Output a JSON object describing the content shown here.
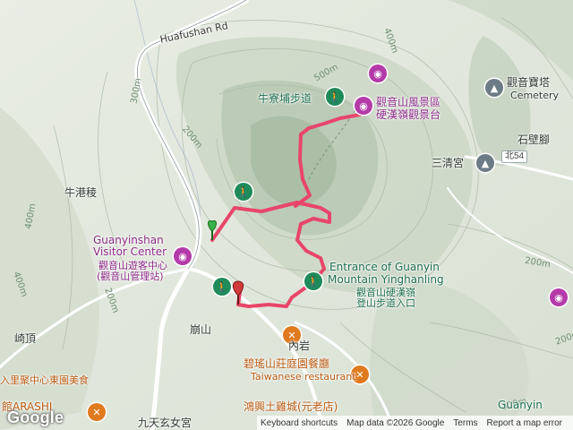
{
  "map": {
    "roads": {
      "main_road": "Huafushan Rd",
      "route_badge": "北54"
    },
    "contours": [
      "400m",
      "500m",
      "300m",
      "200m",
      "400m",
      "200m",
      "200m",
      "300m",
      "400m",
      "200m"
    ],
    "labels": {
      "niu_gang_leng": "牛港稜",
      "beng_shan": "崩山",
      "qi_ding": "崎頂",
      "nei_yan": "內岩",
      "shi_bi_jiao": "石壁腳",
      "cemetery_zh": "觀音寶塔",
      "cemetery_en": "Cemetery",
      "san_qing_gong": "三清宮",
      "jiu_tian": "九天玄女宮"
    },
    "pois": {
      "niuliaopu_trail": "牛寮埔步道",
      "scenic_area_1": "觀音山風景區",
      "scenic_area_2": "硬漢嶺觀景台",
      "visitor_center_en_1": "Guanyinshan",
      "visitor_center_en_2": "Visitor Center",
      "visitor_center_zh_1": "觀音山遊客中心",
      "visitor_center_zh_2": "(觀音山管理站)",
      "entrance_en_1": "Entrance of Guanyin",
      "entrance_en_2": "Mountain Yinghanling",
      "entrance_zh_1": "觀音山硬漢嶺",
      "entrance_zh_2": "登山步道入口",
      "restaurant_1_zh": "碧瑤山莊庭園餐廳",
      "restaurant_1_en": "Taiwanese restaurant",
      "restaurant_2_zh": "鴻興土雞城(元老店)",
      "arashi": "館ARASHI",
      "left_food": "入里聚中心東園美食",
      "guanyin_bottom": "Guanyin"
    },
    "colors": {
      "track": "#e8456a",
      "terrain_light": "#e9ede4",
      "terrain_dark": "#bfcdbb",
      "road": "#ffffff"
    }
  },
  "footer": {
    "keyboard_shortcuts": "Keyboard shortcuts",
    "map_data": "Map data ©2026 Google",
    "terms": "Terms",
    "report": "Report a map error",
    "logo": "Google"
  }
}
